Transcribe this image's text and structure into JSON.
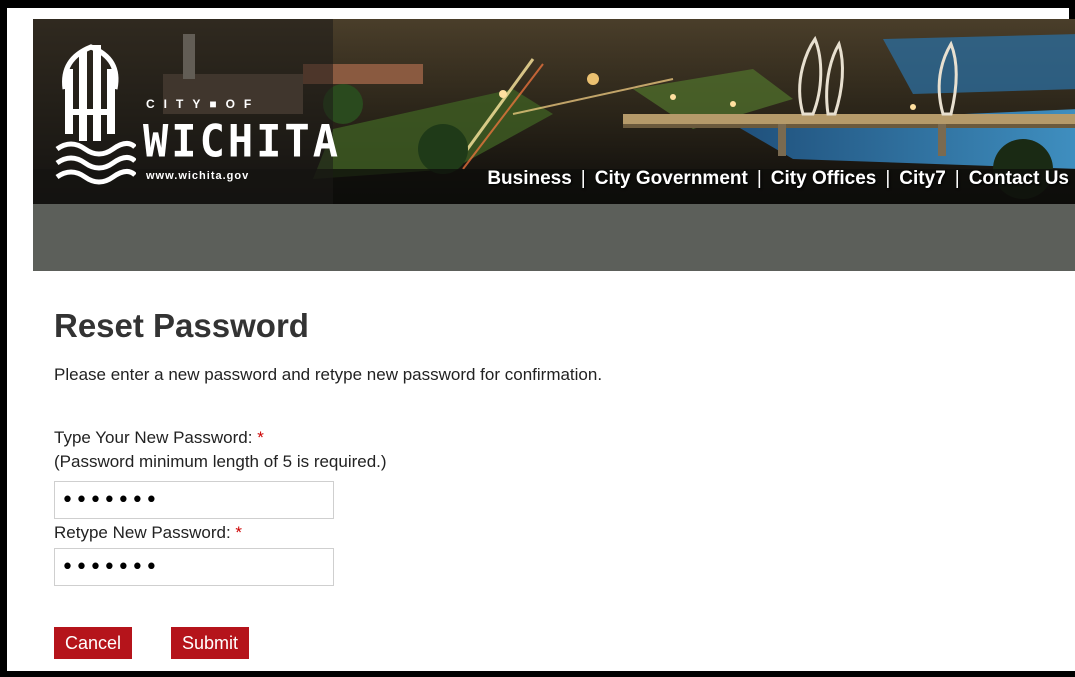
{
  "logo": {
    "city_label": "CITY■OF",
    "name": "WICHITA",
    "url": "www.wichita.gov"
  },
  "nav": {
    "items": [
      {
        "label": "Business"
      },
      {
        "label": "City Government"
      },
      {
        "label": "City Offices"
      },
      {
        "label": "City7"
      },
      {
        "label": "Contact Us"
      }
    ],
    "separator": "|"
  },
  "page": {
    "title": "Reset Password",
    "intro": "Please enter a new password and retype new password for confirmation."
  },
  "form": {
    "new_password_label": "Type Your New Password:",
    "required_mark": "*",
    "new_password_hint": "(Password minimum length of 5 is required.)",
    "new_password_value": "•••••••",
    "retype_label": "Retype New Password:",
    "retype_value": "•••••••"
  },
  "buttons": {
    "cancel": "Cancel",
    "submit": "Submit"
  },
  "colors": {
    "accent": "#b5141b",
    "required": "#cc0000",
    "bar": "#5c5f5a"
  }
}
